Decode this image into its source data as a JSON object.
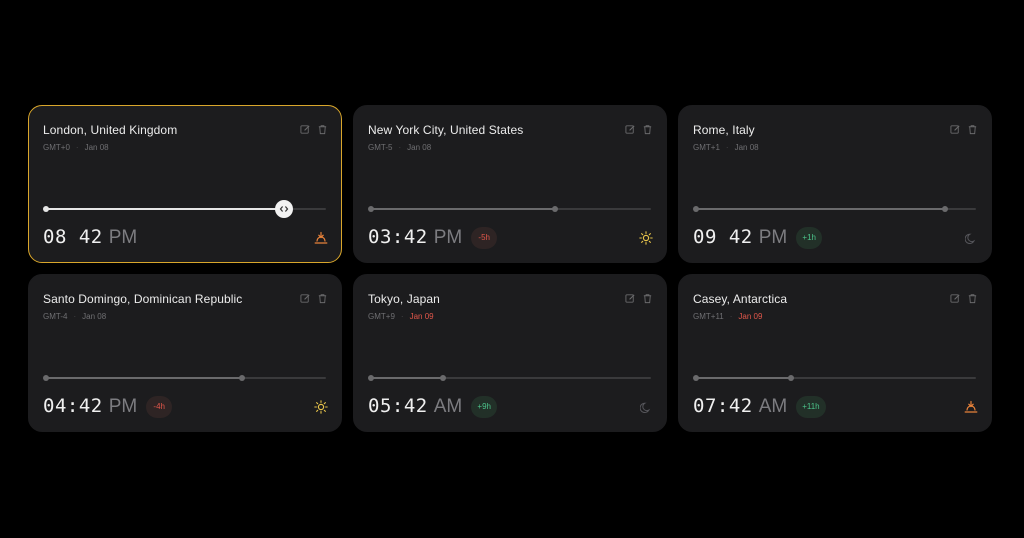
{
  "colors": {
    "selected_border": "#d9a62b",
    "negative": "#e0564a",
    "positive": "#4cc38a",
    "sun": "#e6c34a",
    "sunset": "#e8823a"
  },
  "cards": [
    {
      "city": "London, United Kingdom",
      "gmt": "GMT+0",
      "date": "Jan 08",
      "date_next_day": false,
      "time": "08 42",
      "ampm": "PM",
      "offset": "",
      "progress": 0.85,
      "selected": true,
      "icon": "sunset-icon"
    },
    {
      "city": "New York City, United States",
      "gmt": "GMT-5",
      "date": "Jan 08",
      "date_next_day": false,
      "time": "03:42",
      "ampm": "PM",
      "offset": "-5h",
      "progress": 0.66,
      "selected": false,
      "icon": "sun-icon"
    },
    {
      "city": "Rome, Italy",
      "gmt": "GMT+1",
      "date": "Jan 08",
      "date_next_day": false,
      "time": "09 42",
      "ampm": "PM",
      "offset": "+1h",
      "progress": 0.89,
      "selected": false,
      "icon": "moon-icon"
    },
    {
      "city": "Santo Domingo, Dominican Republic",
      "gmt": "GMT-4",
      "date": "Jan 08",
      "date_next_day": false,
      "time": "04:42",
      "ampm": "PM",
      "offset": "-4h",
      "progress": 0.7,
      "selected": false,
      "icon": "sun-icon"
    },
    {
      "city": "Tokyo, Japan",
      "gmt": "GMT+9",
      "date": "Jan 09",
      "date_next_day": true,
      "time": "05:42",
      "ampm": "AM",
      "offset": "+9h",
      "progress": 0.26,
      "selected": false,
      "icon": "moon-icon"
    },
    {
      "city": "Casey, Antarctica",
      "gmt": "GMT+11",
      "date": "Jan 09",
      "date_next_day": true,
      "time": "07:42",
      "ampm": "AM",
      "offset": "+11h",
      "progress": 0.34,
      "selected": false,
      "icon": "sunset-icon"
    }
  ]
}
